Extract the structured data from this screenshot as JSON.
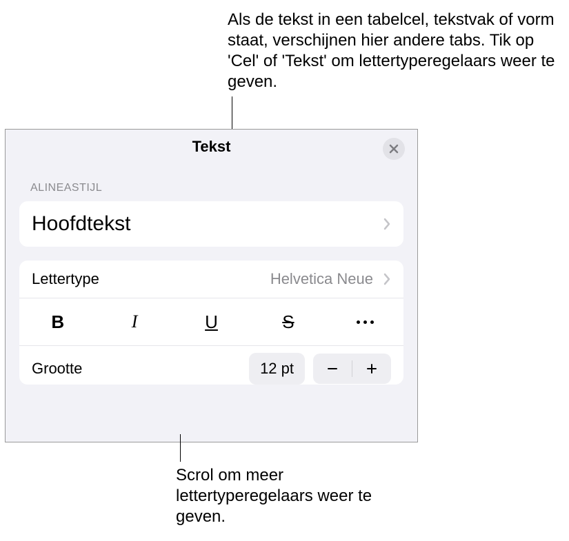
{
  "annotations": {
    "top": "Als de tekst in een tabelcel, tekstvak of vorm staat, verschijnen hier andere tabs. Tik op 'Cel' of 'Tekst' om lettertyperegelaars weer te geven.",
    "bottom": "Scrol om meer lettertyperegelaars weer te geven."
  },
  "panel": {
    "title": "Tekst",
    "section_label": "ALINEASTIJL",
    "paragraph_style": "Hoofdtekst",
    "font_label": "Lettertype",
    "font_value": "Helvetica Neue",
    "styles": {
      "bold": "B",
      "italic": "I",
      "underline": "U",
      "strike": "S"
    },
    "size_label": "Grootte",
    "size_value": "12 pt"
  }
}
